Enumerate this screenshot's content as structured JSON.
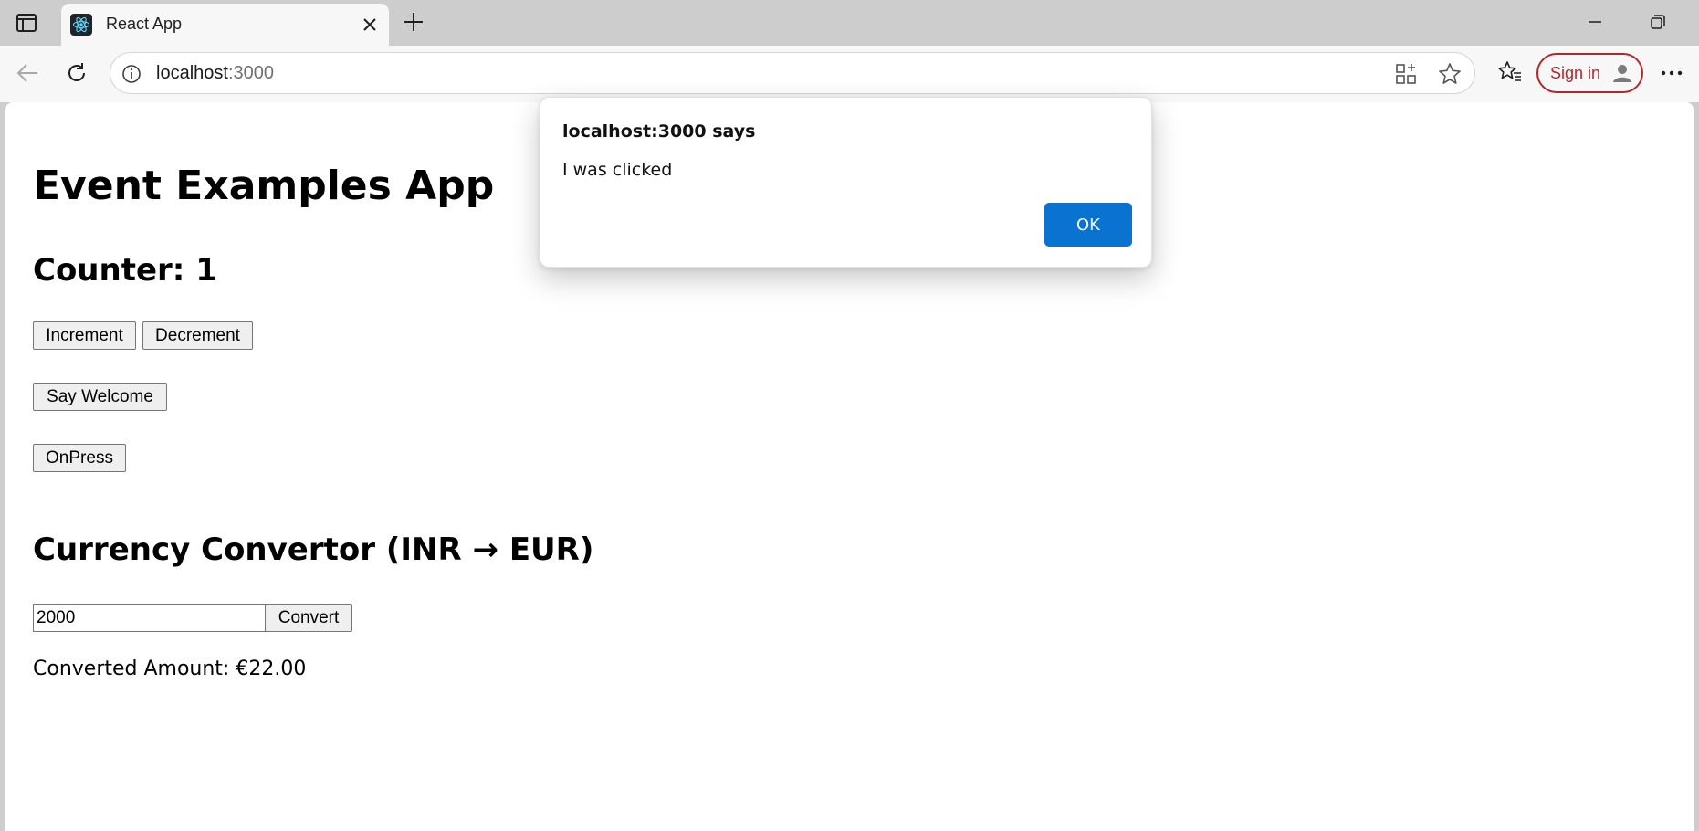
{
  "browser": {
    "tab_title": "React App",
    "url_host": "localhost",
    "url_port": ":3000",
    "sign_in_label": "Sign in"
  },
  "app": {
    "title": "Event Examples App",
    "counter_text": "Counter: 1",
    "increment_label": "Increment",
    "decrement_label": "Decrement",
    "say_welcome_label": "Say Welcome",
    "onpress_label": "OnPress",
    "currency_title": "Currency Convertor (INR → EUR)",
    "amount_value": "2000",
    "convert_label": "Convert",
    "converted_text": "Converted Amount: €22.00"
  },
  "dialog": {
    "title": "localhost:3000 says",
    "message": "I was clicked",
    "ok_label": "OK"
  },
  "colors": {
    "dialog_ok": "#0a72d1",
    "sign_in_border": "#b1282c",
    "react_logo": "#61dafb"
  },
  "icons": {
    "tab_actions": "tab-actions-icon",
    "favicon": "react-logo-icon",
    "tab_close": "close-icon",
    "new_tab": "plus-icon",
    "back": "back-arrow-icon",
    "reload": "reload-icon",
    "site_info": "info-icon",
    "apps": "apps-icon",
    "star": "star-icon",
    "favorites": "favorites-icon",
    "profile": "profile-icon",
    "more": "more-icon"
  }
}
